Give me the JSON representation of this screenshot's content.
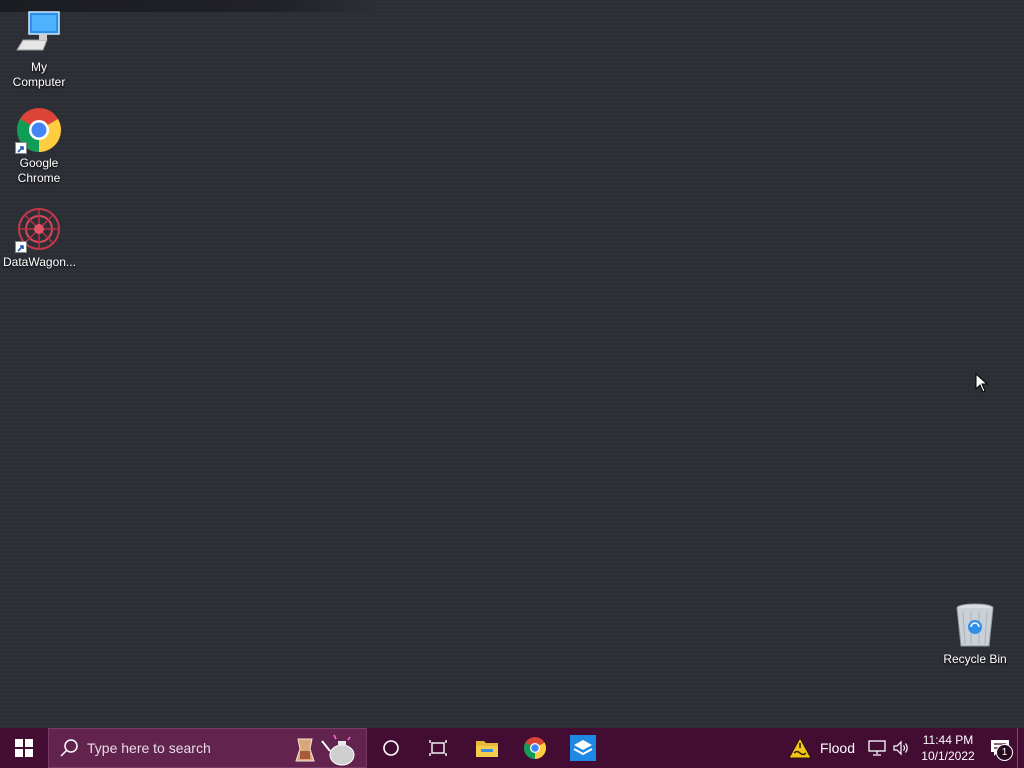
{
  "desktop": {
    "icons": [
      {
        "label": "My Computer",
        "icon": "computer-icon"
      },
      {
        "label": "Google Chrome",
        "icon": "chrome-icon",
        "shortcut": true
      },
      {
        "label": "DataWagon...",
        "icon": "datawagon-icon",
        "shortcut": true
      },
      {
        "label": "Recycle Bin",
        "icon": "recycle-bin-icon"
      }
    ]
  },
  "taskbar": {
    "start_icon": "windows-start-icon",
    "search": {
      "placeholder": "Type here to search",
      "icon": "search-icon"
    },
    "cortana_icon": "cortana-circle-icon",
    "task_view_icon": "task-view-icon",
    "pinned": [
      {
        "icon": "file-explorer-icon"
      },
      {
        "icon": "chrome-icon"
      },
      {
        "icon": "datawagon-app-icon"
      }
    ],
    "tray": {
      "weather_icon": "flood-warning-icon",
      "weather_text": "Flood",
      "network_icon": "network-icon",
      "volume_icon": "volume-icon",
      "time": "11:44 PM",
      "date": "10/1/2022",
      "notifications_icon": "notification-center-icon",
      "notification_count": "1"
    }
  },
  "colors": {
    "desktop_bg": "#2c2e36",
    "taskbar_bg": "#420c33",
    "search_bg": "#62244f"
  }
}
